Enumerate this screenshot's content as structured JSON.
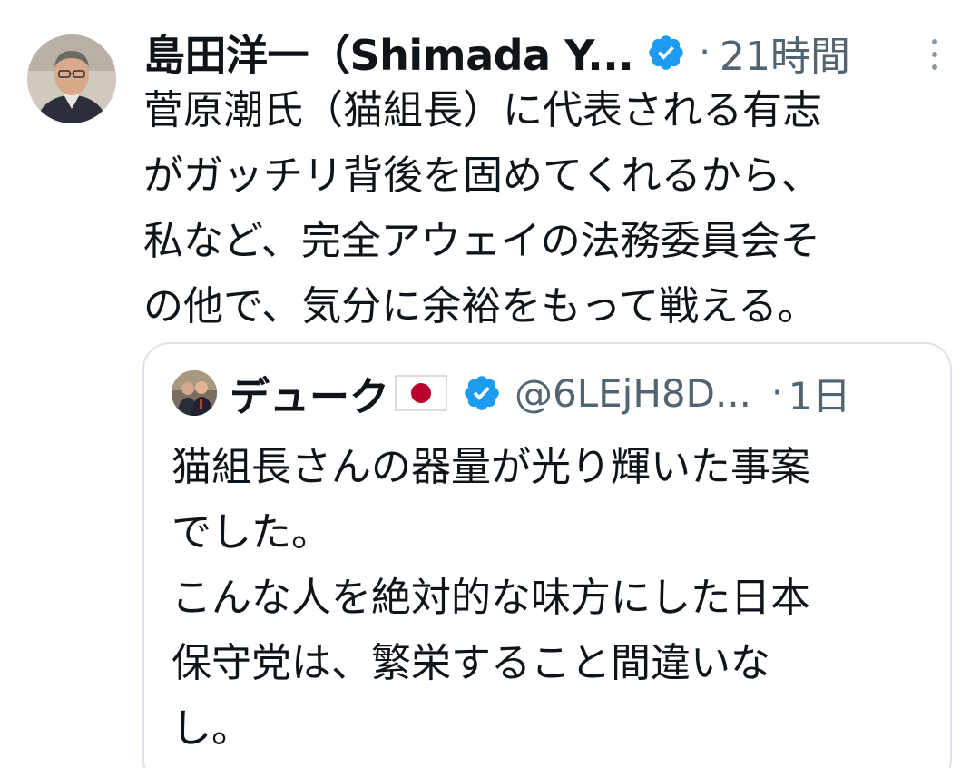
{
  "tweet": {
    "author_name": "島田洋一（Shimada Y...",
    "separator": "·",
    "time": "21時間",
    "text": "菅原潮氏（猫組長）に代表される有志\nがガッチリ背後を固めてくれるから、\n私など、完全アウェイの法務委員会そ\nの他で、気分に余裕をもって戦える。",
    "verified_icon": "verified-badge",
    "avatar_icon": "profile-photo",
    "more_icon": "vertical-ellipsis"
  },
  "quoted_tweet": {
    "author_name": "デューク",
    "flag_icon": "japan-flag",
    "handle": "@6LEjH8D...",
    "separator": "·",
    "time": "1日",
    "text": "猫組長さんの器量が光り輝いた事案\nでした。\nこんな人を絶対的な味方にした日本\n保守党は、繁栄すること間違いな\nし。",
    "verified_icon": "verified-badge",
    "avatar_icon": "profile-photo"
  },
  "colors": {
    "text_primary": "#0f1419",
    "text_secondary": "#536471",
    "verified_blue": "#1d9bf0",
    "border": "#dde3e8",
    "flag_red": "#bc002d"
  }
}
